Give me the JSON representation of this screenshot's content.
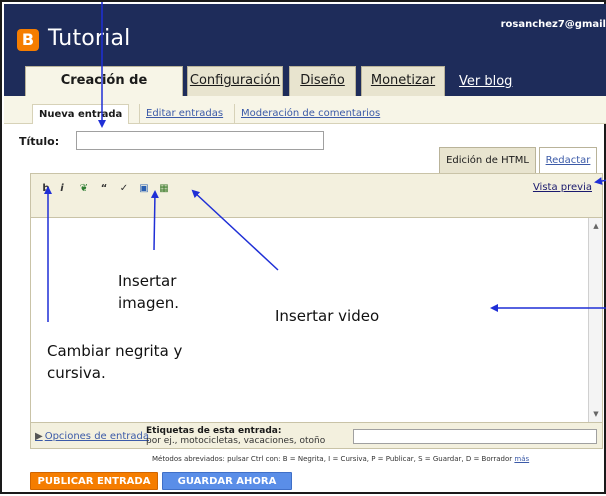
{
  "header": {
    "logo_letter": "B",
    "title": "Tutorial",
    "user": "rosanchez7@gmail",
    "tabs": [
      {
        "label": "Creación de entradas"
      },
      {
        "label": "Configuración"
      },
      {
        "label": "Diseño"
      },
      {
        "label": "Monetizar"
      }
    ],
    "view_blog": "Ver blog"
  },
  "subnav": {
    "items": [
      {
        "label": "Nueva entrada"
      },
      {
        "label": "Editar entradas"
      },
      {
        "label": "Moderación de comentarios"
      }
    ]
  },
  "form": {
    "title_label": "Título:",
    "title_value": "",
    "labels_title": "Etiquetas de esta entrada:",
    "labels_hint": "por ej., motocicletas, vacaciones, otoño",
    "options_link": "Opciones de entrada"
  },
  "editor": {
    "mode_html": "Edición de HTML",
    "mode_compose": "Redactar",
    "preview": "Vista previa",
    "toolbar_icons": [
      "bold-icon",
      "italic-icon",
      "link-icon",
      "quote-icon",
      "spellcheck-icon",
      "insert-image-icon",
      "insert-video-icon"
    ],
    "toolbar_glyphs": [
      "b",
      "i",
      "❦",
      "“",
      "✓",
      "▣",
      "▦"
    ]
  },
  "shortcuts": {
    "text": "Métodos abreviados: pulsar Ctrl con: B = Negrita, I = Cursiva, P = Publicar, S = Guardar, D = Borrador",
    "more": "más"
  },
  "buttons": {
    "publish": "PUBLICAR ENTRADA",
    "save": "GUARDAR AHORA"
  },
  "annotations": {
    "insert_image_1": "Insertar",
    "insert_image_2": "imagen.",
    "insert_video": "Insertar video",
    "bold_italic_1": "Cambiar negrita y",
    "bold_italic_2": "cursiva."
  },
  "colors": {
    "header_bg": "#1e2c5a",
    "brand_orange": "#f57d00",
    "save_blue": "#5a8ee8",
    "arrow_blue": "#1f2fd6"
  }
}
